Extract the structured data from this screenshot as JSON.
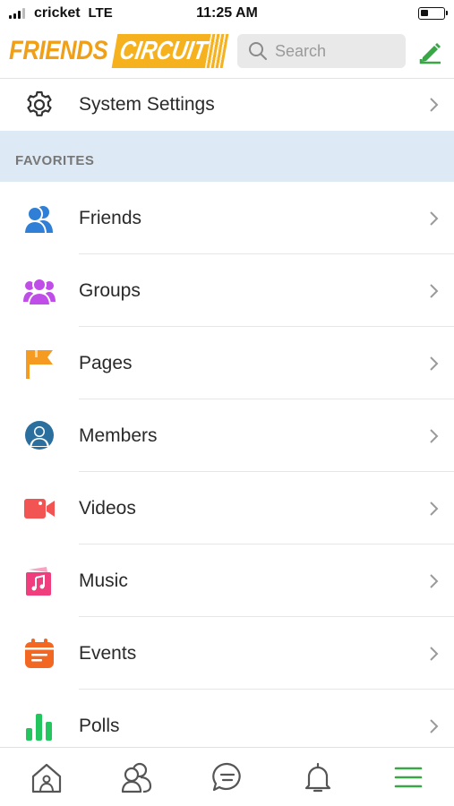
{
  "status_bar": {
    "carrier": "cricket",
    "network": "LTE",
    "time": "11:25 AM",
    "battery_level": 0.35
  },
  "header": {
    "logo_friends": "FRIENDS",
    "logo_circuit": "CIRCUIT",
    "search_placeholder": "Search",
    "accent_color": "#f6b21e",
    "compose_icon": "compose-pencil-icon"
  },
  "settings_item": {
    "label": "System Settings",
    "icon": "gear-icon"
  },
  "favorites": {
    "title": "FAVORITES",
    "items": [
      {
        "label": "Friends",
        "icon": "friends-icon",
        "color": "#2f7fd6"
      },
      {
        "label": "Groups",
        "icon": "groups-icon",
        "color": "#c04de8"
      },
      {
        "label": "Pages",
        "icon": "flag-icon",
        "color": "#f59b22"
      },
      {
        "label": "Members",
        "icon": "members-icon",
        "color": "#2a6f9e"
      },
      {
        "label": "Videos",
        "icon": "video-icon",
        "color": "#f25353"
      },
      {
        "label": "Music",
        "icon": "music-icon",
        "color": "#ef3d7d"
      },
      {
        "label": "Events",
        "icon": "calendar-icon",
        "color": "#f26722"
      },
      {
        "label": "Polls",
        "icon": "poll-icon",
        "color": "#22c55e"
      }
    ]
  },
  "tabbar": {
    "items": [
      {
        "icon": "home-icon"
      },
      {
        "icon": "friends-tab-icon"
      },
      {
        "icon": "messages-icon"
      },
      {
        "icon": "bell-icon"
      },
      {
        "icon": "menu-icon",
        "active": true
      }
    ],
    "active_color": "#3aa648"
  }
}
